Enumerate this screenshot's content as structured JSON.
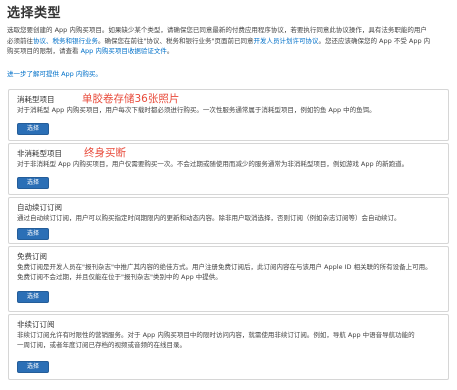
{
  "page": {
    "title": "选择类型",
    "intro": {
      "line1": "选取您要创建的 App 内购买项目。如果缺少某个类型，请确保您已同意最新的付费应用程序协议，若要执行同意此协议操作，具有法务职能的用户",
      "line2_before": "必须前往",
      "line2_link1": "协议、税务和银行业务",
      "line2_middle": "。确保您在前往\"协议、税务和银行业务\"页面前已同意",
      "line2_link2": "开发人员计划许可协议",
      "line2_after": "。您还应该确保您的 App 不受 App 内",
      "line3_before": "购买项目的限制，请查看 ",
      "line3_link": "App 内购买项目收据验证文件",
      "line3_after": "。"
    },
    "learn_more_link": "进一步了解可提供 App 内购买。"
  },
  "cards": [
    {
      "title": "消耗型项目",
      "desc_lines": [
        "对于消耗型 App 内购买项目，用户每次下载时都必须进行购买。一次性服务通常属于消耗型项目，例如钓鱼 App 中的鱼饵。"
      ],
      "button": "选择",
      "annotation": "单胶卷存储36张照片"
    },
    {
      "title": "非消耗型项目",
      "desc_lines": [
        "对于非消耗型 App 内购买项目，用户仅需要购买一次。不会过期或随使用而减少的服务通常为非消耗型项目，例如游戏 App 的新跑道。"
      ],
      "button": "选择",
      "annotation": "终身买断"
    },
    {
      "title": "自动续订订阅",
      "desc_lines": [
        "通过自动续订订阅，用户可以购买指定时间期限内的更新和动态内容。除非用户取消选择，否则订阅（例如杂志订阅等）会自动续订。"
      ],
      "button": "选择",
      "annotation": ""
    },
    {
      "title": "免费订阅",
      "desc_lines": [
        "免费订阅是开发人员在\"报刊杂志\"中推广其内容的绝佳方式。用户注册免费订阅后，此订阅内容在与该用户 Apple ID 相关联的所有设备上可用。",
        "免费订阅不会过期，并且仅能在位于\"报刊杂志\"类别中的 App 中提供。"
      ],
      "button": "选择",
      "annotation": ""
    },
    {
      "title": "非续订订阅",
      "desc_lines": [
        "非续订订阅允许有时限性的营销服务。对于 App 内购买项目中的限时访问内容，就需使用非续订订阅。例如，导航 App 中语音导航功能的",
        "一周订阅，或者年度订阅已存档的视频或音频的在线目录。"
      ],
      "button": "选择",
      "annotation": ""
    }
  ]
}
